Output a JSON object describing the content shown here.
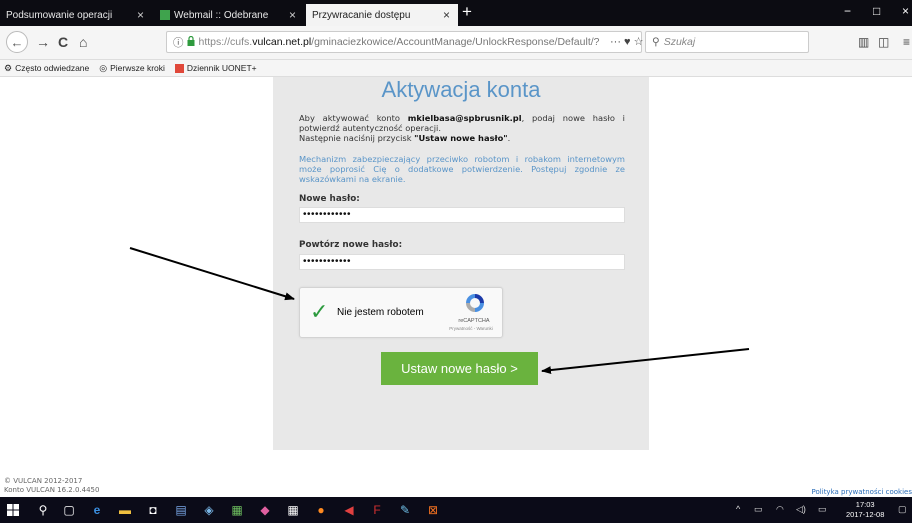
{
  "browser": {
    "tabs": [
      {
        "label": "Podsumowanie operacji",
        "close": "×"
      },
      {
        "label": "Webmail :: Odebrane",
        "close": "×"
      },
      {
        "label": "Przywracanie dostępu",
        "close": "×"
      }
    ],
    "new_tab": "+",
    "window_controls": {
      "minimize": "−",
      "maximize": "□",
      "close": "×"
    },
    "nav": {
      "back": "←",
      "forward": "→",
      "reload": "C",
      "home": "⌂"
    },
    "url": {
      "prefix": "https://cufs.",
      "host": "vulcan.net.pl",
      "path": "/gminaciezkowice/AccountManage/UnlockResponse/Default/?"
    },
    "url_actions": "··· ♥ ☆",
    "search_placeholder": "Szukaj",
    "bookmarks": [
      {
        "label": "Często odwiedzane",
        "icon": "gear-icon"
      },
      {
        "label": "Pierwsze kroki",
        "icon": "firefox-icon"
      },
      {
        "label": "Dziennik UONET+",
        "icon": "dziennik-icon"
      }
    ]
  },
  "page": {
    "title": "Aktywacja konta",
    "intro_before": "Aby aktywować konto ",
    "account": "mkielbasa@spbrusnik.pl",
    "intro_after": ", podaj nowe hasło i potwierdź autentyczność operacji.",
    "intro_next_before": "Następnie naciśnij przycisk ",
    "intro_next_button": "\"Ustaw nowe hasło\"",
    "intro_next_after": ".",
    "note": "Mechanizm zabezpieczający przeciwko robotom i robakom internetowym może poprosić Cię o dodatkowe potwierdzenie. Postępuj zgodnie ze wskazówkami na ekranie.",
    "new_password_label": "Nowe hasło:",
    "new_password_value": "••••••••••••",
    "repeat_password_label": "Powtórz nowe hasło:",
    "repeat_password_value": "••••••••••••",
    "captcha": {
      "label": "Nie jestem robotem",
      "brand": "reCAPTCHA",
      "terms": "Prywatność - Warunki"
    },
    "submit_label": "Ustaw nowe hasło >",
    "footer_copyright": "© VULCAN 2012-2017",
    "footer_version": "Konto VULCAN 16.2.0.4450",
    "privacy_link": "Polityka prywatności cookies"
  },
  "taskbar": {
    "clock_time": "17:03",
    "clock_date": "2017-12-08"
  },
  "colors": {
    "accent_blue": "#5a95c8",
    "button_green": "#6ab33e",
    "panel_gray": "#e8e8e8"
  }
}
